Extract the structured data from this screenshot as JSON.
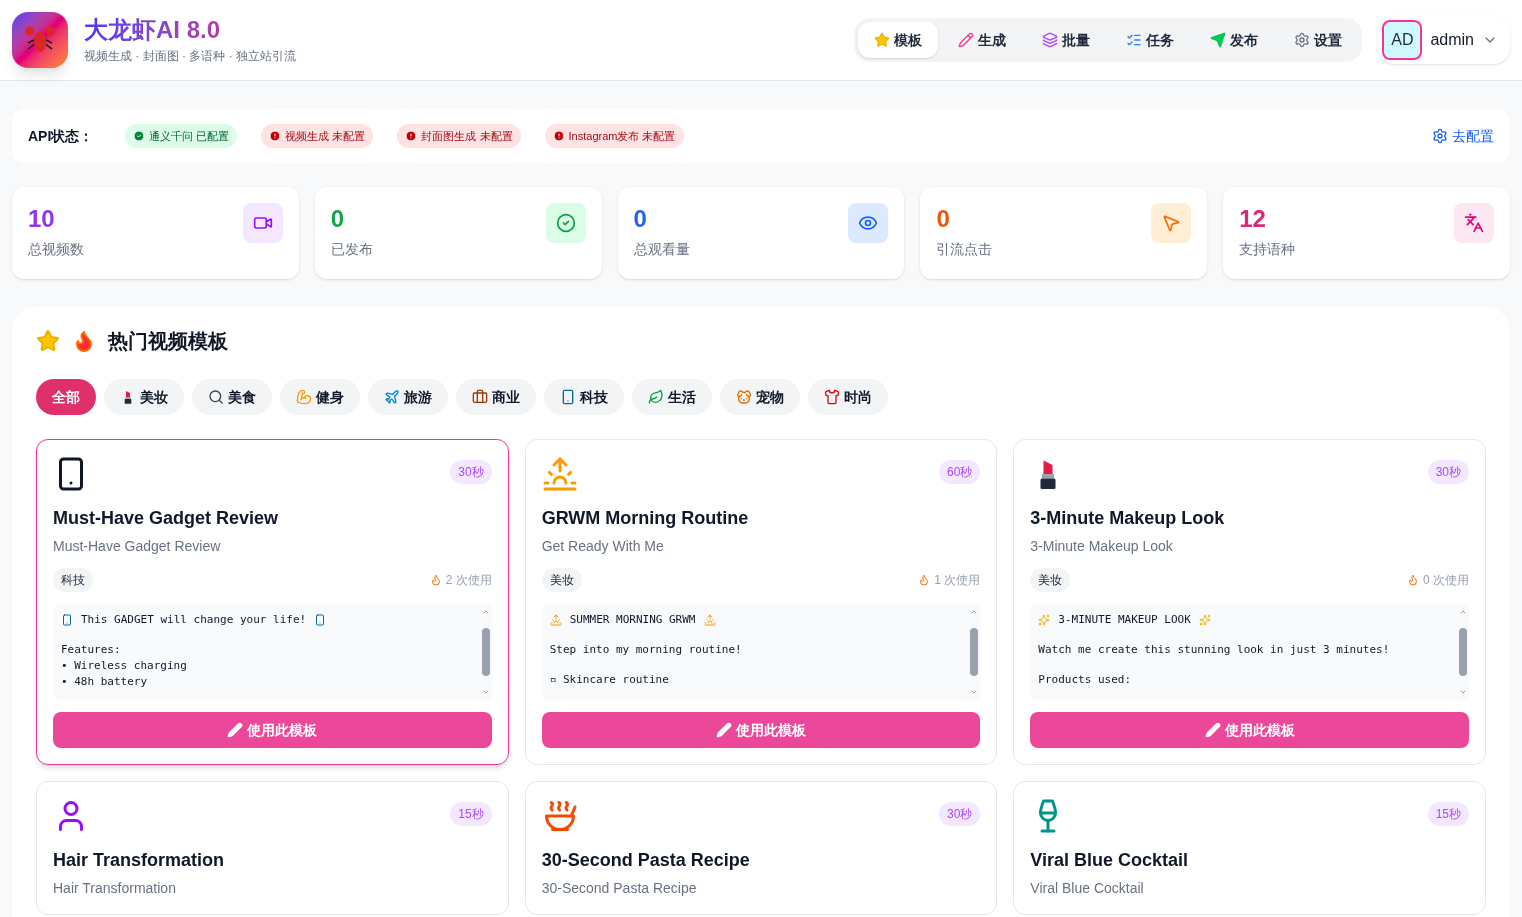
{
  "app": {
    "title": "大龙虾AI 8.0",
    "subtitle": "视频生成 · 封面图 · 多语种 · 独立站引流"
  },
  "nav": [
    {
      "label": "模板",
      "selected": true
    },
    {
      "label": "生成",
      "selected": false
    },
    {
      "label": "批量",
      "selected": false
    },
    {
      "label": "任务",
      "selected": false
    },
    {
      "label": "发布",
      "selected": false
    },
    {
      "label": "设置",
      "selected": false
    }
  ],
  "user": {
    "initials": "AD",
    "name": "admin"
  },
  "api_status": {
    "label": "API状态：",
    "items": [
      {
        "label": "通义千问 已配置",
        "ok": true
      },
      {
        "label": "视频生成 未配置",
        "ok": false
      },
      {
        "label": "封面图生成 未配置",
        "ok": false
      },
      {
        "label": "Instagram发布 未配置",
        "ok": false
      }
    ],
    "action": "去配置"
  },
  "stats": [
    {
      "value": "10",
      "label": "总视频数",
      "color": "#9333ea"
    },
    {
      "value": "0",
      "label": "已发布",
      "color": "#16a34a"
    },
    {
      "value": "0",
      "label": "总观看量",
      "color": "#2563eb"
    },
    {
      "value": "0",
      "label": "引流点击",
      "color": "#ea580c"
    },
    {
      "value": "12",
      "label": "支持语种",
      "color": "#db2777"
    }
  ],
  "templates": {
    "title": "热门视频模板",
    "filters": [
      {
        "label": "全部",
        "selected": true
      },
      {
        "label": "美妆",
        "selected": false
      },
      {
        "label": "美食",
        "selected": false
      },
      {
        "label": "健身",
        "selected": false
      },
      {
        "label": "旅游",
        "selected": false
      },
      {
        "label": "商业",
        "selected": false
      },
      {
        "label": "科技",
        "selected": false
      },
      {
        "label": "生活",
        "selected": false
      },
      {
        "label": "宠物",
        "selected": false
      },
      {
        "label": "时尚",
        "selected": false
      }
    ],
    "cards": [
      {
        "title": "Must-Have Gadget Review",
        "subtitle": "Must-Have Gadget Review",
        "duration": "30秒",
        "category": "科技",
        "uses": "2 次使用",
        "button": "使用此模板",
        "selected": true,
        "script": [
          [
            "This GADGET will change your life!"
          ],
          [
            "Features:",
            "• Wireless charging",
            "• 48h battery"
          ]
        ]
      },
      {
        "title": "GRWM Morning Routine",
        "subtitle": "Get Ready With Me",
        "duration": "60秒",
        "category": "美妆",
        "uses": "1 次使用",
        "button": "使用此模板",
        "selected": false,
        "script": [
          [
            "SUMMER MORNING GRWM"
          ],
          [
            "Step into my morning routine!"
          ],
          [
            "▫ Skincare routine"
          ]
        ]
      },
      {
        "title": "3-Minute Makeup Look",
        "subtitle": "3-Minute Makeup Look",
        "duration": "30秒",
        "category": "美妆",
        "uses": "0 次使用",
        "button": "使用此模板",
        "selected": false,
        "script": [
          [
            "3-MINUTE MAKEUP LOOK"
          ],
          [
            "Watch me create this stunning look in just 3 minutes!"
          ],
          [
            "Products used:"
          ]
        ]
      },
      {
        "title": "Hair Transformation",
        "subtitle": "Hair Transformation",
        "duration": "15秒",
        "selected": false
      },
      {
        "title": "30-Second Pasta Recipe",
        "subtitle": "30-Second Pasta Recipe",
        "duration": "30秒",
        "selected": false
      },
      {
        "title": "Viral Blue Cocktail",
        "subtitle": "Viral Blue Cocktail",
        "duration": "15秒",
        "selected": false
      }
    ]
  }
}
